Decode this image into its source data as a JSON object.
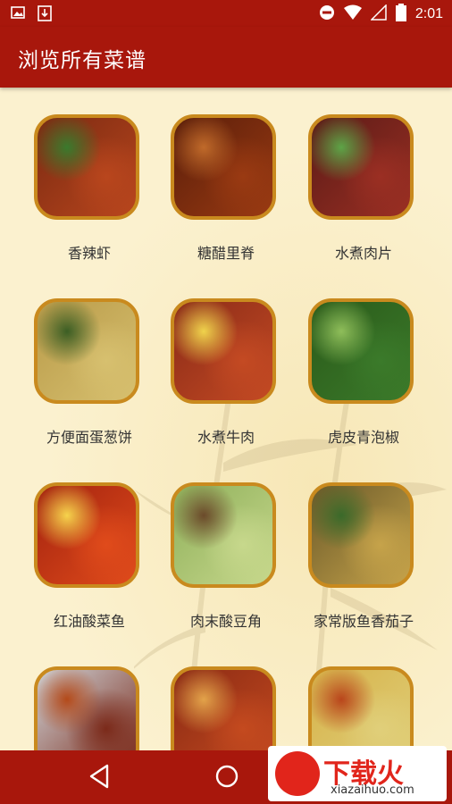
{
  "status_bar": {
    "time": "2:01"
  },
  "app_bar": {
    "title": "浏览所有菜谱"
  },
  "recipes": [
    {
      "name": "香辣虾",
      "img_colors": [
        "#7b2a12",
        "#b9461d",
        "#3a7a2d"
      ]
    },
    {
      "name": "糖醋里脊",
      "img_colors": [
        "#5a1e0a",
        "#9a3a12",
        "#c06a2a"
      ]
    },
    {
      "name": "水煮肉片",
      "img_colors": [
        "#5b1b17",
        "#9b2f23",
        "#5da447"
      ]
    },
    {
      "name": "方便面蛋葱饼",
      "img_colors": [
        "#b99b4a",
        "#d7c06f",
        "#3b5e24"
      ]
    },
    {
      "name": "水煮牛肉",
      "img_colors": [
        "#8a2b18",
        "#c44a23",
        "#f0d34c"
      ]
    },
    {
      "name": "虎皮青泡椒",
      "img_colors": [
        "#2a5a1a",
        "#3b7a2a",
        "#8fbe5a"
      ]
    },
    {
      "name": "红油酸菜鱼",
      "img_colors": [
        "#a3230f",
        "#e04b1b",
        "#f6d34c"
      ]
    },
    {
      "name": "肉末酸豆角",
      "img_colors": [
        "#8fb05b",
        "#c7d88c",
        "#6b4a2a"
      ]
    },
    {
      "name": "家常版鱼香茄子",
      "img_colors": [
        "#6b5a2a",
        "#c6a34a",
        "#3a6a2a"
      ]
    },
    {
      "name": "",
      "img_colors": [
        "#cfd4d8",
        "#7b2a1a",
        "#b44a1a"
      ]
    },
    {
      "name": "",
      "img_colors": [
        "#8a2a14",
        "#c44a1f",
        "#e3a34a"
      ]
    },
    {
      "name": "",
      "img_colors": [
        "#d6b24a",
        "#e0cf7a",
        "#b9451b"
      ]
    }
  ],
  "nav": {
    "back": "back-icon",
    "home": "home-icon"
  },
  "watermark": {
    "main": "下载火",
    "sub": "xiazaihuo.com"
  }
}
